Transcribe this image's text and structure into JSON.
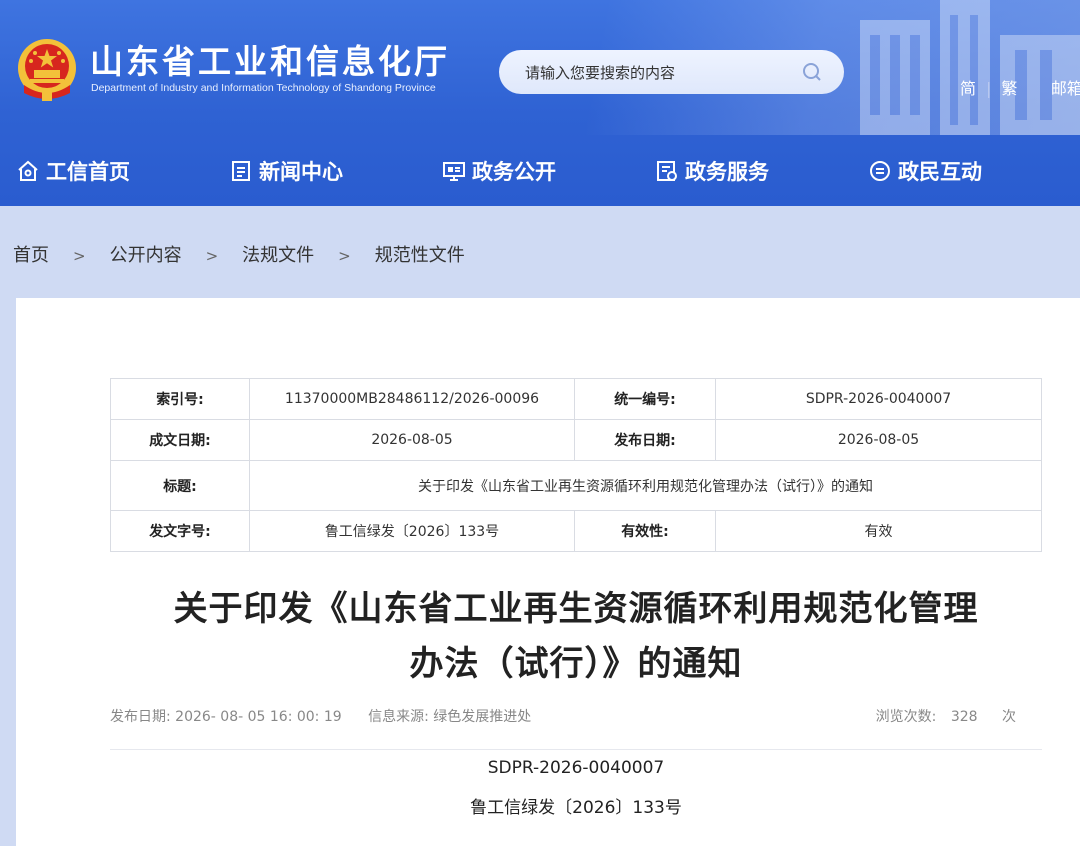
{
  "header": {
    "title": "山东省工业和信息化厅",
    "subtitle": "Department of Industry and Information Technology of Shandong Province",
    "search_placeholder": "请输入您要搜索的内容",
    "links": [
      "简",
      "繁",
      "邮箱"
    ]
  },
  "nav": [
    {
      "label": "工信首页",
      "icon": "home-icon"
    },
    {
      "label": "新闻中心",
      "icon": "document-icon"
    },
    {
      "label": "政务公开",
      "icon": "monitor-icon"
    },
    {
      "label": "政务服务",
      "icon": "service-icon"
    },
    {
      "label": "政民互动",
      "icon": "chat-icon"
    }
  ],
  "breadcrumb": [
    "首页",
    "公开内容",
    "法规文件",
    "规范性文件"
  ],
  "breadcrumb_sep": ">",
  "meta": {
    "index_label": "索引号:",
    "index_value": "11370000MB28486112/2026-00096",
    "code_label": "统一编号:",
    "code_value": "SDPR-2026-0040007",
    "date_label": "成文日期:",
    "date_value": "2026-08-05",
    "pub_label": "发布日期:",
    "pub_value": "2026-08-05",
    "title_label": "标题:",
    "title_value": "关于印发《山东省工业再生资源循环利用规范化管理办法（试行）》的通知",
    "docno_label": "发文字号:",
    "docno_value": "鲁工信绿发〔2026〕133号",
    "valid_label": "有效性:",
    "valid_value": "有效"
  },
  "article": {
    "title_line1": "关于印发《山东省工业再生资源循环利用规范化管理",
    "title_line2": "办法（试行）》的通知",
    "pub_date": "发布日期: 2026- 08- 05 16: 00: 19",
    "source": "信息来源: 绿色发展推进处",
    "views_label": "浏览次数:",
    "views_count": "328",
    "views_unit": "次",
    "doc_code": "SDPR-2026-0040007",
    "doc_no": "鲁工信绿发〔2026〕133号"
  },
  "colors": {
    "header_blue": "#2f62d3",
    "page_bg": "#cfdaf3",
    "emblem_red": "#d7261e",
    "emblem_gold": "#f3c13a"
  }
}
